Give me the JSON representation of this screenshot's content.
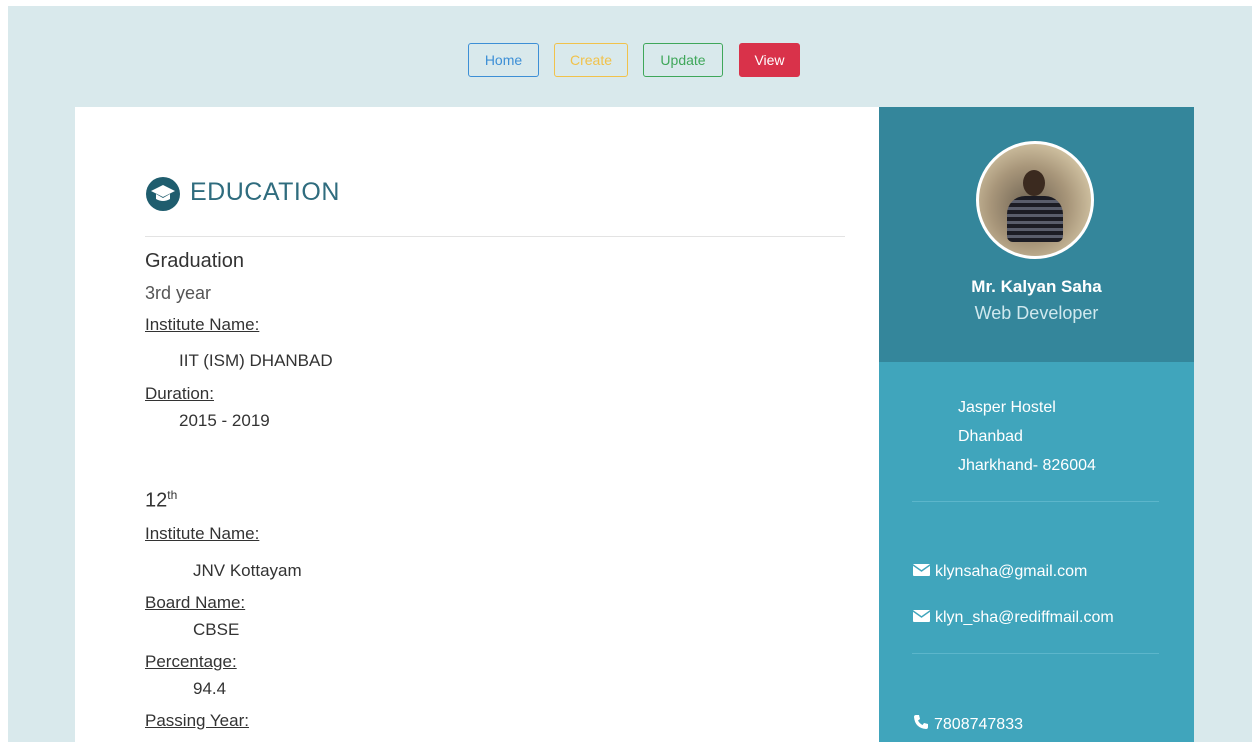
{
  "nav": {
    "home": "Home",
    "create": "Create",
    "update": "Update",
    "view": "View"
  },
  "education": {
    "title": "EDUCATION",
    "graduation": {
      "title": "Graduation",
      "year": "3rd year",
      "institute_label": "Institute Name:",
      "institute": "IIT (ISM) DHANBAD",
      "duration_label": "Duration:",
      "duration": "2015 - 2019"
    },
    "twelfth": {
      "title_base": "12",
      "title_sup": "th",
      "institute_label": "Institute Name:",
      "institute": "JNV Kottayam",
      "board_label": "Board Name:",
      "board": "CBSE",
      "percentage_label": "Percentage:",
      "percentage": "94.4",
      "passing_year_label": "Passing Year:"
    }
  },
  "profile": {
    "name": "Mr. Kalyan Saha",
    "role": "Web Developer",
    "address": [
      "Jasper Hostel",
      "Dhanbad",
      "Jharkhand- 826004"
    ],
    "emails": [
      "klynsaha@gmail.com",
      "klyn_sha@rediffmail.com"
    ],
    "phone": "7808747833"
  },
  "colors": {
    "page_bg": "#d9e9ec",
    "profile_top": "#34869b",
    "profile_bottom": "#40a5bc",
    "home": "#3d8fd6",
    "create": "#f1c24b",
    "update": "#3fa75a",
    "view": "#d9324a",
    "heading": "#2f6c7e"
  },
  "icons": {
    "education": "graduation-cap-icon",
    "email": "envelope-icon",
    "phone": "phone-icon"
  }
}
